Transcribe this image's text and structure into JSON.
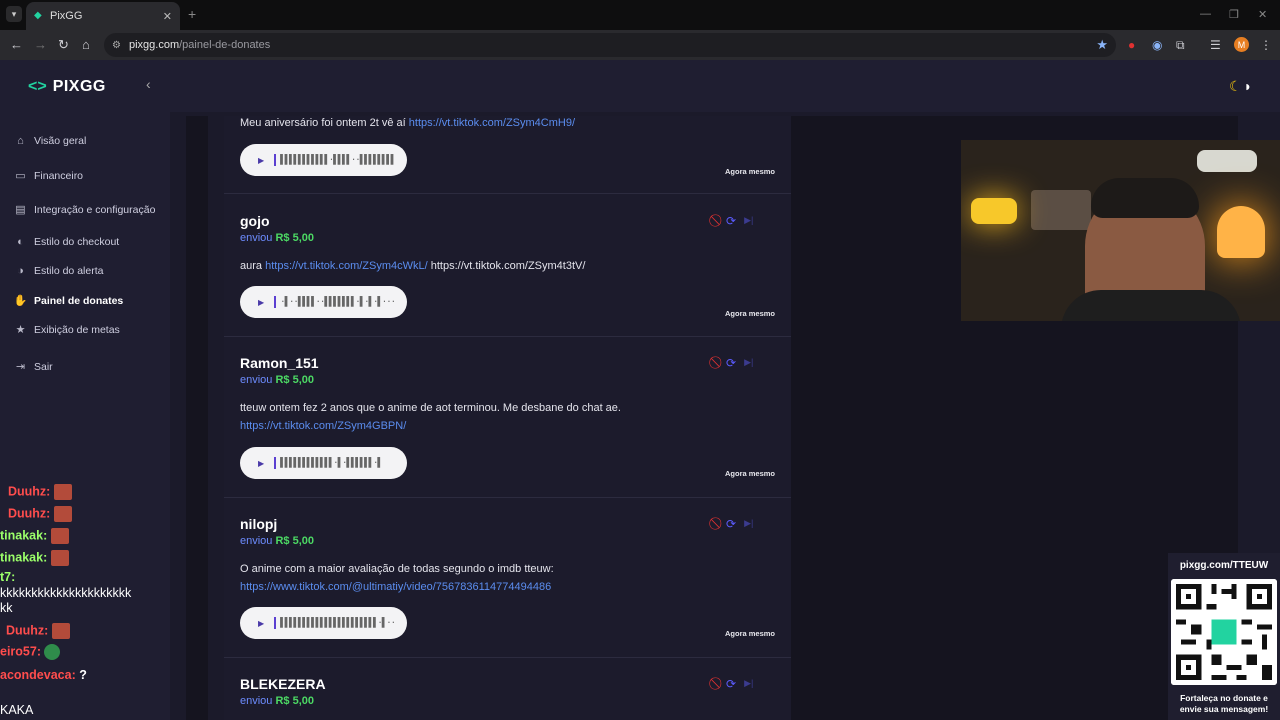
{
  "browser": {
    "tab_title": "PixGG",
    "url_domain": "pixgg.com",
    "url_path": "/painel-de-donates",
    "profile_initial": "M"
  },
  "sidebar": {
    "brand": "PIXGG",
    "items": [
      {
        "label": "Visão geral",
        "icon": "home-icon"
      },
      {
        "label": "Financeiro",
        "icon": "wallet-icon"
      },
      {
        "label": "Integração e configuração",
        "icon": "settings-icon"
      },
      {
        "label": "Estilo do checkout",
        "icon": "palette-icon"
      },
      {
        "label": "Estilo do alerta",
        "icon": "palette-icon"
      },
      {
        "label": "Painel de donates",
        "icon": "donate-icon",
        "active": true
      },
      {
        "label": "Exibição de metas",
        "icon": "star-icon"
      },
      {
        "label": "Sair",
        "icon": "logout-icon"
      }
    ]
  },
  "chat": [
    {
      "user": "Duuhz:",
      "text": "",
      "color": "#ff4d4d"
    },
    {
      "user": "Duuhz:",
      "text": "",
      "color": "#ff4d4d"
    },
    {
      "user": "tinakak:",
      "text": "",
      "color": "#9bff6a"
    },
    {
      "user": "tinakak:",
      "text": "",
      "color": "#9bff6a"
    },
    {
      "user": "t7:",
      "text": "",
      "color": "#9bff6a"
    },
    {
      "user": "",
      "text": "kkkkkkkkkkkkkkkkkkkkk",
      "color": "#ffffff"
    },
    {
      "user": "",
      "text": "kk",
      "color": "#ffffff"
    },
    {
      "user": "Duuhz:",
      "text": "",
      "color": "#ff4d4d"
    },
    {
      "user": "eiro57:",
      "text": "",
      "color": "#ff4d4d"
    },
    {
      "user": "acondevaca:",
      "text": "?",
      "color": "#ff4d4d"
    },
    {
      "user": "",
      "text": "KAKA",
      "color": "#ffffff"
    }
  ],
  "donations": [
    {
      "name": "",
      "amount_prefix": "",
      "amount": "",
      "message": "Meu aniversário foi ontem 2t vê aí",
      "link": "https://vt.tiktok.com/ZSym4CmH9/",
      "link2": "",
      "time": "Agora mesmo"
    },
    {
      "name": "gojo",
      "amount_prefix": "enviou",
      "amount": "R$ 5,00",
      "message": "aura",
      "link": "https://vt.tiktok.com/ZSym4cWkL/",
      "link2": "https://vt.tiktok.com/ZSym4t3tV/",
      "time": "Agora mesmo"
    },
    {
      "name": "Ramon_151",
      "amount_prefix": "enviou",
      "amount": "R$ 5,00",
      "message": "tteuw ontem fez 2 anos que o anime de aot terminou. Me desbane do chat ae.",
      "link": "https://vt.tiktok.com/ZSym4GBPN/",
      "link2": "",
      "time": "Agora mesmo"
    },
    {
      "name": "nilopj",
      "amount_prefix": "enviou",
      "amount": "R$ 5,00",
      "message": "O anime com a maior avaliação de todas segundo o imdb tteuw:",
      "link": "https://www.tiktok.com/@ultimatiy/video/7567836114774494486",
      "link2": "",
      "time": "Agora mesmo"
    },
    {
      "name": "BLEKEZERA",
      "amount_prefix": "enviou",
      "amount": "R$ 5,00",
      "message": "",
      "link": "",
      "link2": "",
      "time": ""
    }
  ],
  "waveforms": [
    "▌▌▌▌▌▌▌▌▌▌▌·▌▌▌▌··▌▌▌▌▌▌▌▌",
    "·▌··▌▌▌▌··▌▌▌▌▌▌▌·▌·▌·▌···",
    "▌▌▌▌▌▌▌▌▌▌▌▌·▌·▌▌▌▌▌▌·▌",
    "▌▌▌▌▌▌▌▌▌▌▌▌▌▌▌▌▌▌▌▌▌▌·▌··"
  ],
  "overlay": {
    "qr_url": "pixgg.com/TTEUW",
    "qr_caption_1": "Fortaleça no donate e",
    "qr_caption_2": "envie sua mensagem!"
  }
}
